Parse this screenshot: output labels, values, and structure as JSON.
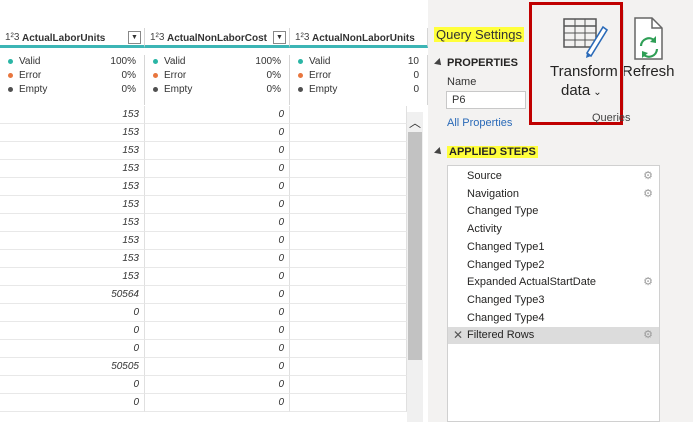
{
  "grid": {
    "columns": [
      {
        "type_label": "1²3",
        "name": "ActualLaborUnits",
        "stats": [
          {
            "label": "Valid",
            "pct": "100%",
            "color": "#2ab5a5"
          },
          {
            "label": "Error",
            "pct": "0%",
            "color": "#e8763e"
          },
          {
            "label": "Empty",
            "pct": "0%",
            "color": "#505050"
          }
        ]
      },
      {
        "type_label": "1²3",
        "name": "ActualNonLaborCost",
        "stats": [
          {
            "label": "Valid",
            "pct": "100%",
            "color": "#2ab5a5"
          },
          {
            "label": "Error",
            "pct": "0%",
            "color": "#e8763e"
          },
          {
            "label": "Empty",
            "pct": "0%",
            "color": "#505050"
          }
        ]
      },
      {
        "type_label": "1²3",
        "name": "ActualNonLaborUnits",
        "stats": [
          {
            "label": "Valid",
            "pct": "10",
            "color": "#2ab5a5"
          },
          {
            "label": "Error",
            "pct": "0",
            "color": "#e8763e"
          },
          {
            "label": "Empty",
            "pct": "0",
            "color": "#505050"
          }
        ]
      }
    ],
    "rows": [
      [
        "153",
        "0",
        ""
      ],
      [
        "153",
        "0",
        ""
      ],
      [
        "153",
        "0",
        ""
      ],
      [
        "153",
        "0",
        ""
      ],
      [
        "153",
        "0",
        ""
      ],
      [
        "153",
        "0",
        ""
      ],
      [
        "153",
        "0",
        ""
      ],
      [
        "153",
        "0",
        ""
      ],
      [
        "153",
        "0",
        ""
      ],
      [
        "153",
        "0",
        ""
      ],
      [
        "50564",
        "0",
        ""
      ],
      [
        "0",
        "0",
        ""
      ],
      [
        "0",
        "0",
        ""
      ],
      [
        "0",
        "0",
        ""
      ],
      [
        "50505",
        "0",
        ""
      ],
      [
        "0",
        "0",
        ""
      ],
      [
        "0",
        "0",
        ""
      ]
    ]
  },
  "query_settings": {
    "title": "Query Settings",
    "properties_heading": "PROPERTIES",
    "name_label": "Name",
    "name_value": "P6",
    "all_properties": "All Properties",
    "applied_steps_heading": "APPLIED STEPS",
    "steps": [
      {
        "label": "Source",
        "gear": true
      },
      {
        "label": "Navigation",
        "gear": true
      },
      {
        "label": "Changed Type",
        "gear": false
      },
      {
        "label": "Activity",
        "gear": false
      },
      {
        "label": "Changed Type1",
        "gear": false
      },
      {
        "label": "Changed Type2",
        "gear": false
      },
      {
        "label": "Expanded ActualStartDate",
        "gear": true
      },
      {
        "label": "Changed Type3",
        "gear": false
      },
      {
        "label": "Changed Type4",
        "gear": false
      },
      {
        "label": "Filtered Rows",
        "gear": true,
        "selected": true
      }
    ]
  },
  "ribbon": {
    "transform_label_1": "Transform",
    "transform_label_2": "data",
    "refresh_label": "Refresh",
    "group_label": "Queries"
  },
  "colors": {
    "accent": "#3cb5b5",
    "highlight_box": "#c00000",
    "highlight_text": "#ffff3b"
  }
}
